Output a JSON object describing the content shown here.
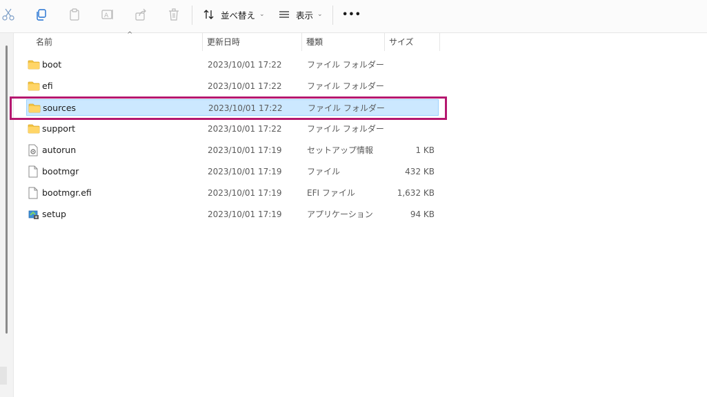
{
  "toolbar": {
    "sort_label": "並べ替え",
    "view_label": "表示",
    "more_label": "•••",
    "chevron": "⌄"
  },
  "columns": {
    "name": "名前",
    "date": "更新日時",
    "type": "種類",
    "size": "サイズ",
    "sort_indicator": "^"
  },
  "files": [
    {
      "name": "boot",
      "date": "2023/10/01 17:22",
      "type": "ファイル フォルダー",
      "size": "",
      "icon": "folder-icon"
    },
    {
      "name": "efi",
      "date": "2023/10/01 17:22",
      "type": "ファイル フォルダー",
      "size": "",
      "icon": "folder-icon"
    },
    {
      "name": "sources",
      "date": "2023/10/01 17:22",
      "type": "ファイル フォルダー",
      "size": "",
      "icon": "folder-icon",
      "selected": true
    },
    {
      "name": "support",
      "date": "2023/10/01 17:22",
      "type": "ファイル フォルダー",
      "size": "",
      "icon": "folder-icon"
    },
    {
      "name": "autorun",
      "date": "2023/10/01 17:19",
      "type": "セットアップ情報",
      "size": "1 KB",
      "icon": "settings-file-icon"
    },
    {
      "name": "bootmgr",
      "date": "2023/10/01 17:19",
      "type": "ファイル",
      "size": "432 KB",
      "icon": "file-icon"
    },
    {
      "name": "bootmgr.efi",
      "date": "2023/10/01 17:19",
      "type": "EFI ファイル",
      "size": "1,632 KB",
      "icon": "file-icon"
    },
    {
      "name": "setup",
      "date": "2023/10/01 17:19",
      "type": "アプリケーション",
      "size": "94 KB",
      "icon": "setup-app-icon"
    }
  ],
  "colors": {
    "selection": "#cce8ff",
    "highlight_box": "#b5176f",
    "folder": "#f4c542"
  }
}
